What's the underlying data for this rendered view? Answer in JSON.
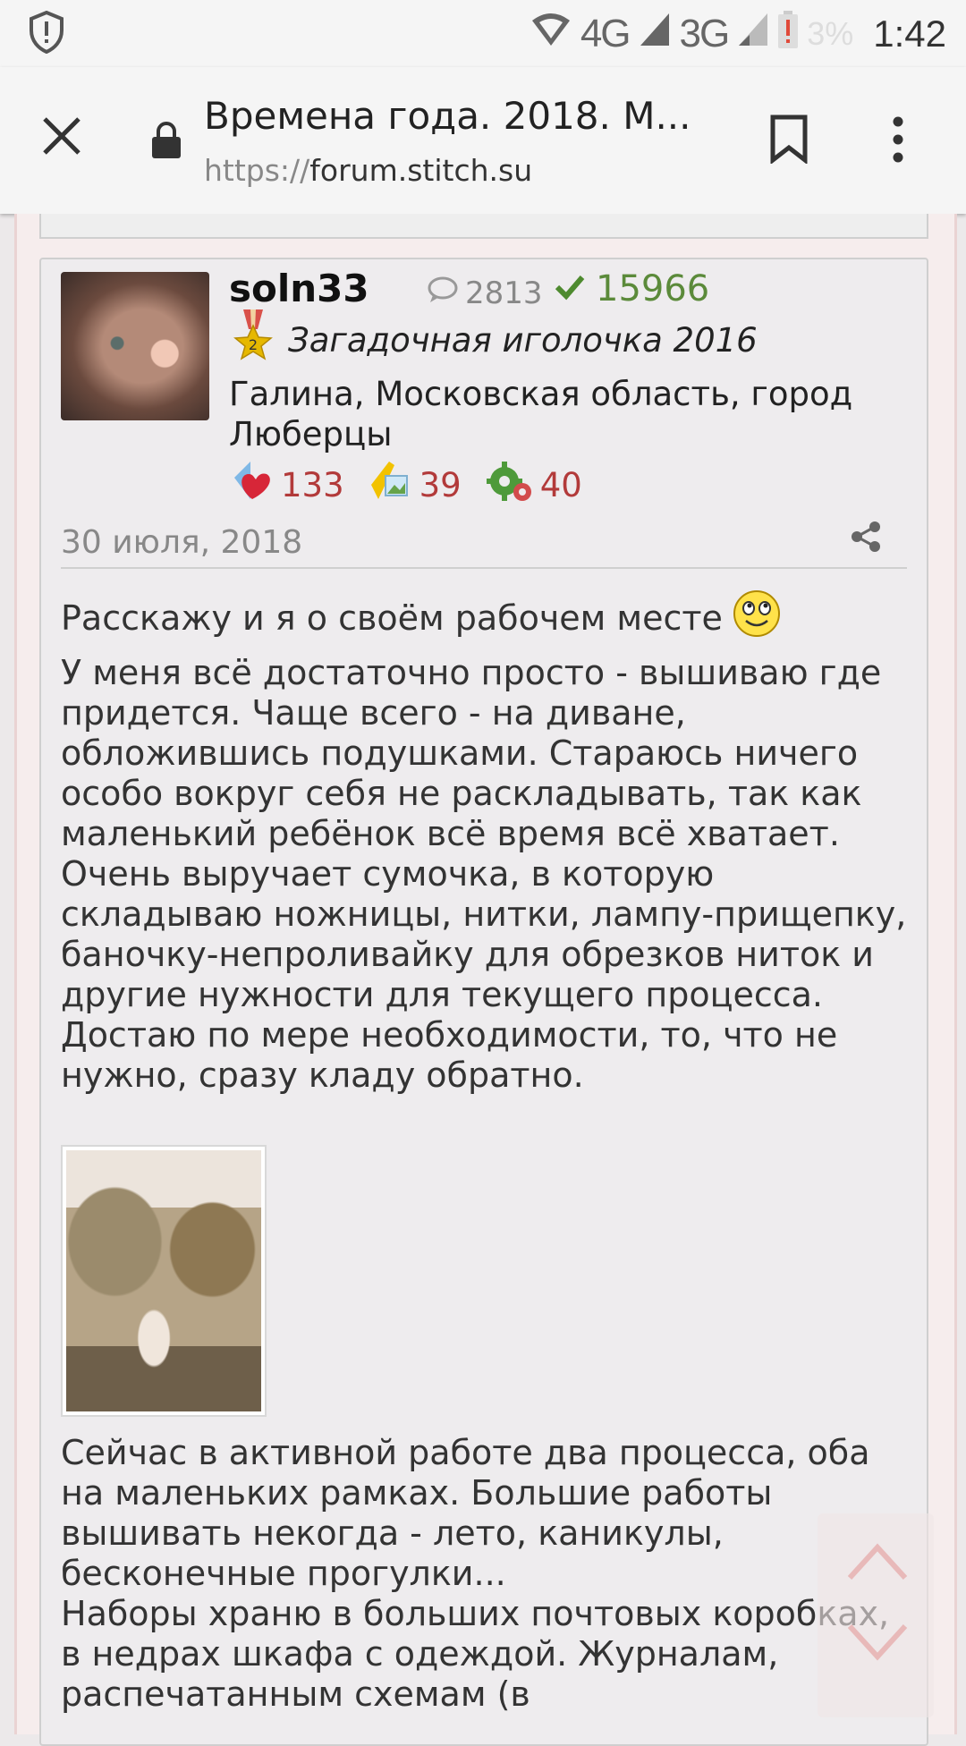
{
  "statusbar": {
    "net1": "4G",
    "net2": "3G",
    "battery": "3%",
    "time": "1:42"
  },
  "toolbar": {
    "title": "Времена года. 2018. М...",
    "url_scheme": "https://",
    "url_host": "forum.stitch.su"
  },
  "post": {
    "username": "soln33",
    "message_count": "2813",
    "likes": "15966",
    "award_number": "2",
    "award_title": "Загадочная иголочка 2016",
    "location": "Галина, Московская область, город Люберцы",
    "stats": [
      {
        "icon": "heart-icon",
        "value": "133"
      },
      {
        "icon": "picture-icon",
        "value": "39"
      },
      {
        "icon": "gear-icon",
        "value": "40"
      }
    ],
    "date": "30 июля, 2018",
    "lead": "Расскажу и я о своём рабочем месте",
    "paragraph1": "У меня всё достаточно просто - вышиваю где придется. Чаще всего - на диване, обложившись подушками. Стараюсь ничего особо вокруг себя не раскладывать, так как маленький ребёнок всё время всё хватает. Очень выручает сумочка, в которую складываю ножницы, нитки, лампу-прищепку, баночку-непроливайку для обрезков ниток и другие нужности для текущего процесса. Достаю по мере необходимости, то, что не нужно, сразу кладу обратно.",
    "paragraph2": "Сейчас в активной работе два процесса, оба на маленьких рамках. Большие работы вышивать некогда - лето, каникулы, бесконечные прогулки...\nНаборы храню в больших почтовых коробках, в недрах шкафа с одеждой. Журналам, распечатанным схемам (в"
  }
}
